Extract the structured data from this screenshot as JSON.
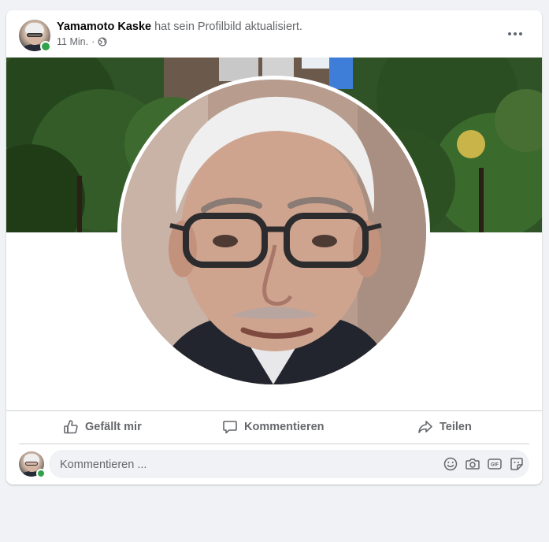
{
  "post": {
    "author": "Yamamoto Kaske",
    "action_text": " hat sein Profilbild aktualisiert.",
    "time": "11 Min.",
    "separator": "·",
    "privacy_icon": "globe-icon",
    "more_icon": "more-horizontal-icon"
  },
  "actions": {
    "like_label": "Gefällt mir",
    "comment_label": "Kommentieren",
    "share_label": "Teilen"
  },
  "comment": {
    "placeholder": "Kommentieren ...",
    "icons": [
      "emoji-icon",
      "camera-icon",
      "gif-icon",
      "sticker-icon"
    ]
  },
  "colors": {
    "background": "#f0f2f5",
    "text_secondary": "#65676b",
    "online": "#31a24c"
  }
}
